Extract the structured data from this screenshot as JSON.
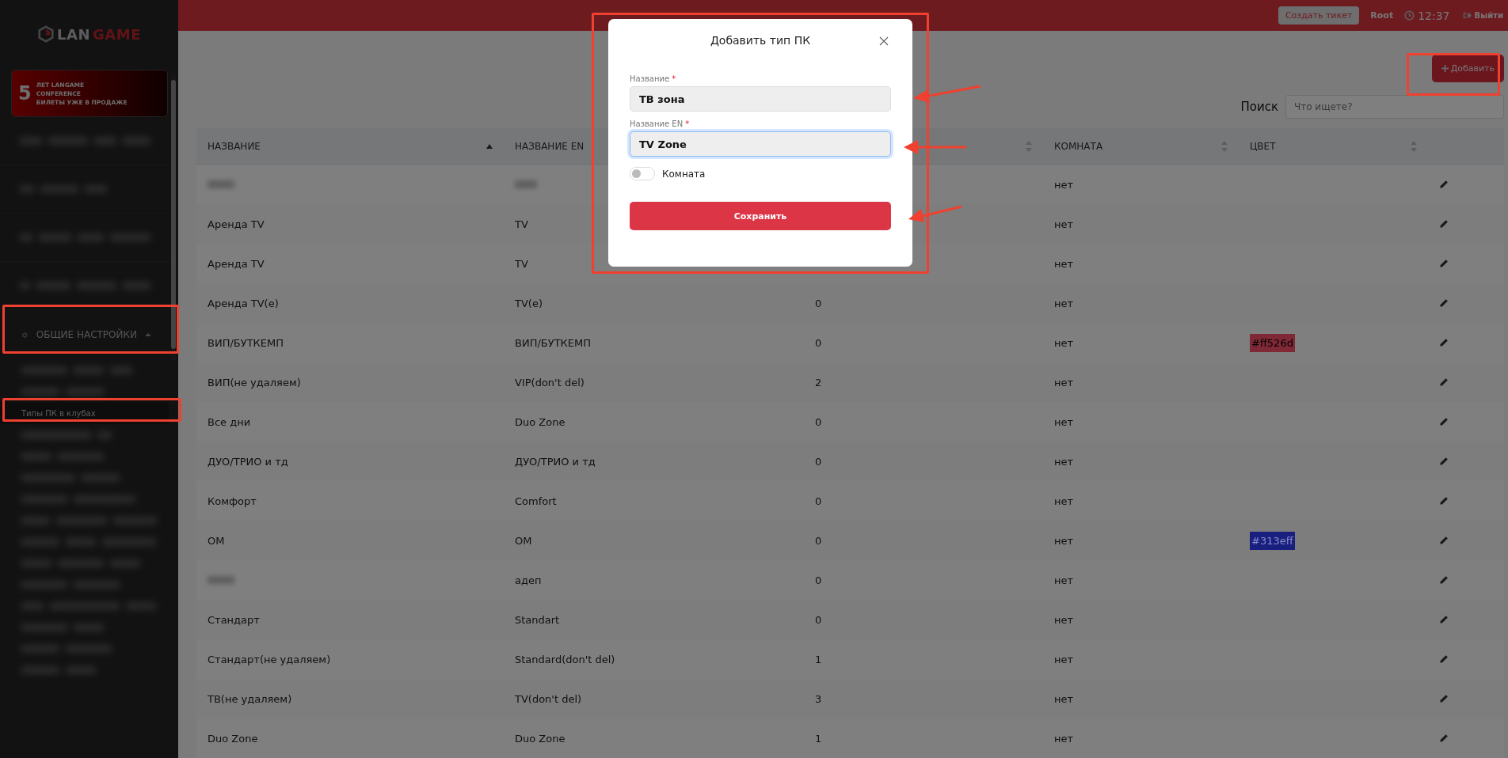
{
  "sidebar": {
    "logo": [
      "LAN",
      "GAME"
    ],
    "banner": {
      "number": "5",
      "lines": [
        "ЛЕТ LANGAME",
        "CONFERENCE",
        "БИЛЕТЫ УЖЕ В ПРОДАЖЕ"
      ]
    },
    "section": {
      "label": "ОБЩИЕ НАСТРОЙКИ",
      "expanded": true
    },
    "subitems": [
      {
        "label": "Типы ПК в клубах",
        "selected": true
      }
    ]
  },
  "header": {
    "ticket_button": "Создать тикет",
    "user": "Root",
    "time": "12:37",
    "logout": "Выйти"
  },
  "add_button": "Добавить",
  "search": {
    "label": "Поиск",
    "placeholder": "Что ищете?"
  },
  "table": {
    "columns": [
      {
        "label": "НАЗВАНИЕ",
        "sorted": true
      },
      {
        "label": "НАЗВАНИЕ EN"
      },
      {
        "sorted": false
      },
      {
        "label": "КОМНАТА",
        "sorted": false
      },
      {
        "label": "ЦВЕТ",
        "sorted": false
      }
    ],
    "rows": [
      {
        "room": "нет",
        "blurred": true
      },
      {
        "name": "Аренда TV",
        "name_en": "TV",
        "room": "нет"
      },
      {
        "name": "Аренда TV",
        "name_en": "TV",
        "room": "нет"
      },
      {
        "name": "Аренда TV(e)",
        "name_en": "TV(e)",
        "count": "0",
        "room": "нет"
      },
      {
        "name": "ВИП/БУТКЕМП",
        "name_en": "ВИП/БУТКЕМП",
        "count": "0",
        "room": "нет",
        "color_label": "#ff526d",
        "color": "#7f2936"
      },
      {
        "name": "ВИП(не удаляем)",
        "name_en": "VIP(don't del)",
        "count": "2",
        "room": "нет"
      },
      {
        "name": "Все дни",
        "name_en": "Duo Zone",
        "count": "0",
        "room": "нет"
      },
      {
        "name": "ДУО/ТРИО и тд",
        "name_en": "ДУО/ТРИО и тд",
        "count": "0",
        "room": "нет"
      },
      {
        "name": "Комфорт",
        "name_en": "Comfort",
        "count": "0",
        "room": "нет"
      },
      {
        "name": "ОМ",
        "name_en": "ОМ",
        "count": "0",
        "room": "нет",
        "color_label": "#313eff",
        "color": "#181f7f"
      },
      {
        "name_en": "адеп",
        "count": "0",
        "room": "нет",
        "blurred": true
      },
      {
        "name": "Стандарт",
        "name_en": "Standart",
        "count": "0",
        "room": "нет"
      },
      {
        "name": "Стандарт(не удаляем)",
        "name_en": "Standard(don't del)",
        "count": "1",
        "room": "нет"
      },
      {
        "name": "ТВ(не удаляем)",
        "name_en": "TV(don't del)",
        "count": "3",
        "room": "нет"
      },
      {
        "name": "Duo Zone",
        "name_en": "Duo Zone",
        "count": "1",
        "room": "нет"
      }
    ]
  },
  "modal": {
    "title": "Добавить тип ПК",
    "fields": [
      {
        "label": "Название",
        "required_mark": "*",
        "value": "ТВ зона",
        "focused": false
      },
      {
        "label": "Название EN",
        "required_mark": "*",
        "value": "TV Zone",
        "focused": true
      }
    ],
    "toggle": {
      "label": "Комната",
      "on": false
    },
    "save_button": "Сохранить"
  }
}
